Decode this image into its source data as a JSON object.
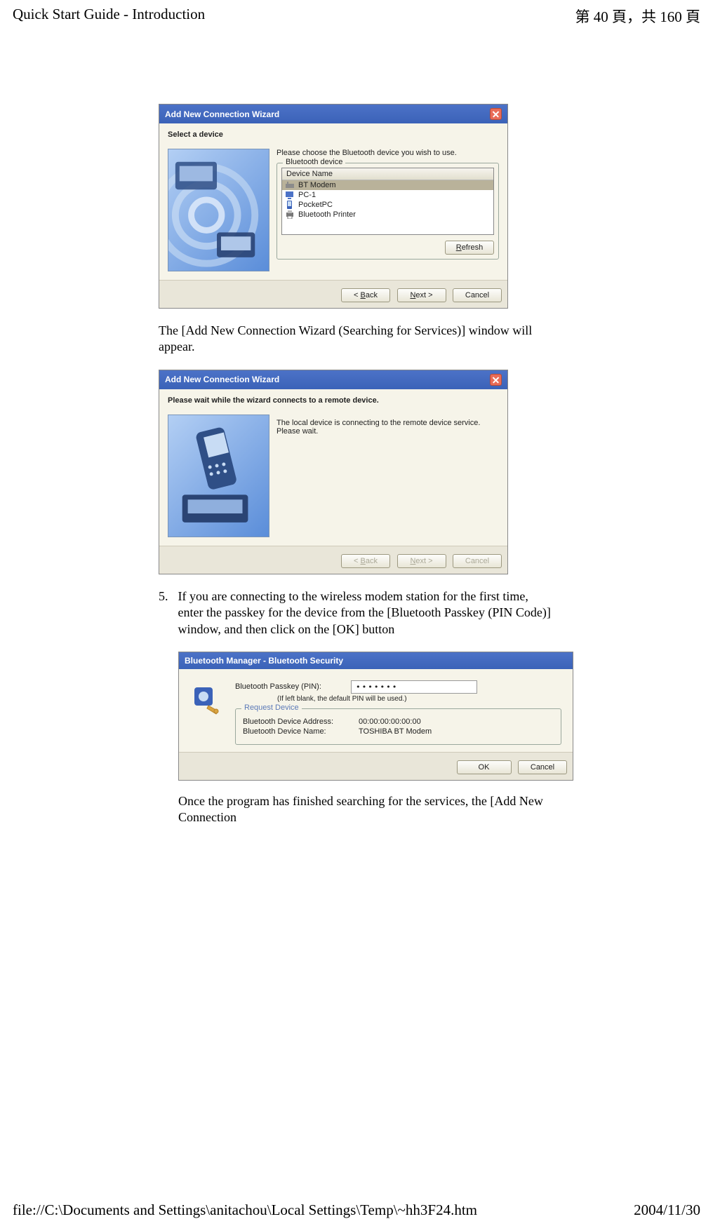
{
  "header": {
    "title": "Quick Start Guide - Introduction",
    "page_info": "第 40 頁，共 160 頁"
  },
  "wiz1": {
    "title": "Add New Connection Wizard",
    "step": "Select a device",
    "prompt": "Please choose the Bluetooth device you wish to use.",
    "legend": "Bluetooth device",
    "col": "Device Name",
    "items": [
      "BT Modem",
      "PC-1",
      "PocketPC",
      "Bluetooth Printer"
    ],
    "refresh": "Refresh",
    "back": "< Back",
    "next": "Next >",
    "cancel": "Cancel"
  },
  "para1": "The [Add New Connection Wizard (Searching for Services)] window will appear.",
  "wiz2": {
    "title": "Add New Connection Wizard",
    "step": "Please wait while the wizard connects to a remote device.",
    "msg1": "The local device is connecting to the remote device service.",
    "msg2": "Please wait.",
    "back": "< Back",
    "next": "Next >",
    "cancel": "Cancel"
  },
  "step5": {
    "num": "5.",
    "text": "If you are connecting to the wireless modem station for the first time, enter the passkey for the device from the [Bluetooth Passkey (PIN Code)] window, and then click on the [OK] button"
  },
  "sec": {
    "title": "Bluetooth Manager - Bluetooth Security",
    "pin_label": "Bluetooth Passkey (PIN):",
    "pin_value": "•••••••",
    "hint": "(If left blank, the default PIN will be used.)",
    "req_legend": "Request Device",
    "addr_l": "Bluetooth Device Address:",
    "addr_v": "00:00:00:00:00:00",
    "name_l": "Bluetooth Device Name:",
    "name_v": "TOSHIBA BT Modem",
    "ok": "OK",
    "cancel": "Cancel"
  },
  "para2": "Once the program has finished searching for the services, the [Add New Connection",
  "footer": {
    "path": "file://C:\\Documents and Settings\\anitachou\\Local Settings\\Temp\\~hh3F24.htm",
    "date": "2004/11/30"
  }
}
